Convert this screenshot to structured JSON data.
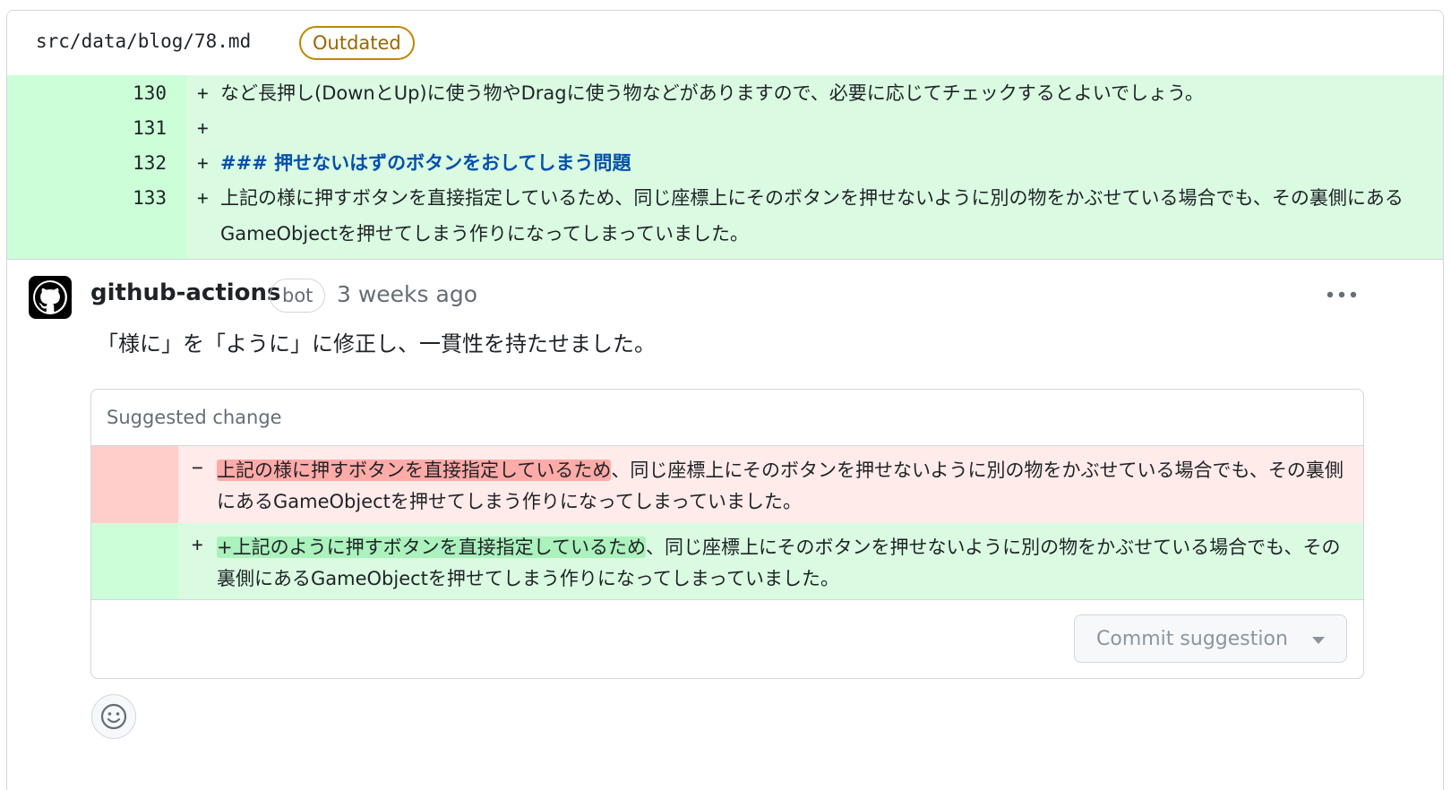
{
  "file": {
    "path": "src/data/blog/78.md",
    "badge": "Outdated"
  },
  "diff": {
    "lines": [
      {
        "num": "130",
        "sign": "+",
        "text": "など長押し(DownとUp)に使う物やDragに使う物などがありますので、必要に応じてチェックするとよいでしょう。"
      },
      {
        "num": "131",
        "sign": "+",
        "text": ""
      },
      {
        "num": "132",
        "sign": "+",
        "text": "### 押せないはずのボタンをおしてしまう問題"
      },
      {
        "num": "133",
        "sign": "+",
        "text": "上記の様に押すボタンを直接指定しているため、同じ座標上にそのボタンを押せないように別の物をかぶせている場合でも、その裏側にあるGameObjectを押せてしまう作りになってしまっていました。"
      }
    ]
  },
  "comment": {
    "author": "github-actions",
    "badge": "bot",
    "timestamp": "3 weeks ago",
    "body": "「様に」を「ように」に修正し、一貫性を持たせました。"
  },
  "suggestion": {
    "title": "Suggested change",
    "deleted": {
      "sign": "−",
      "highlight": "上記の様に押すボタンを直接指定しているため",
      "rest": "、同じ座標上にそのボタンを押せないように別の物をかぶせている場合でも、その裏側にあるGameObjectを押せてしまう作りになってしまっていました。"
    },
    "added": {
      "sign": "+",
      "highlight": "+上記のように押すボタンを直接指定しているため",
      "rest": "、同じ座標上にそのボタンを押せないように別の物をかぶせている場合でも、その裏側にあるGameObjectを押せてしまう作りになってしまっていました。"
    },
    "commit_label": "Commit suggestion"
  },
  "icons": {
    "avatar": "github-octocat-icon",
    "more": "kebab-horizontal-icon",
    "caret": "triangle-down-icon",
    "reaction": "smiley-icon"
  },
  "colors": {
    "outdated": "#9a6700",
    "diff_add_bg": "#dafbe1",
    "diff_add_gutter": "#ccffd8",
    "diff_del_bg": "#ffebe9",
    "diff_del_gutter": "#ffcecb",
    "heading_blue": "#0550ae"
  }
}
